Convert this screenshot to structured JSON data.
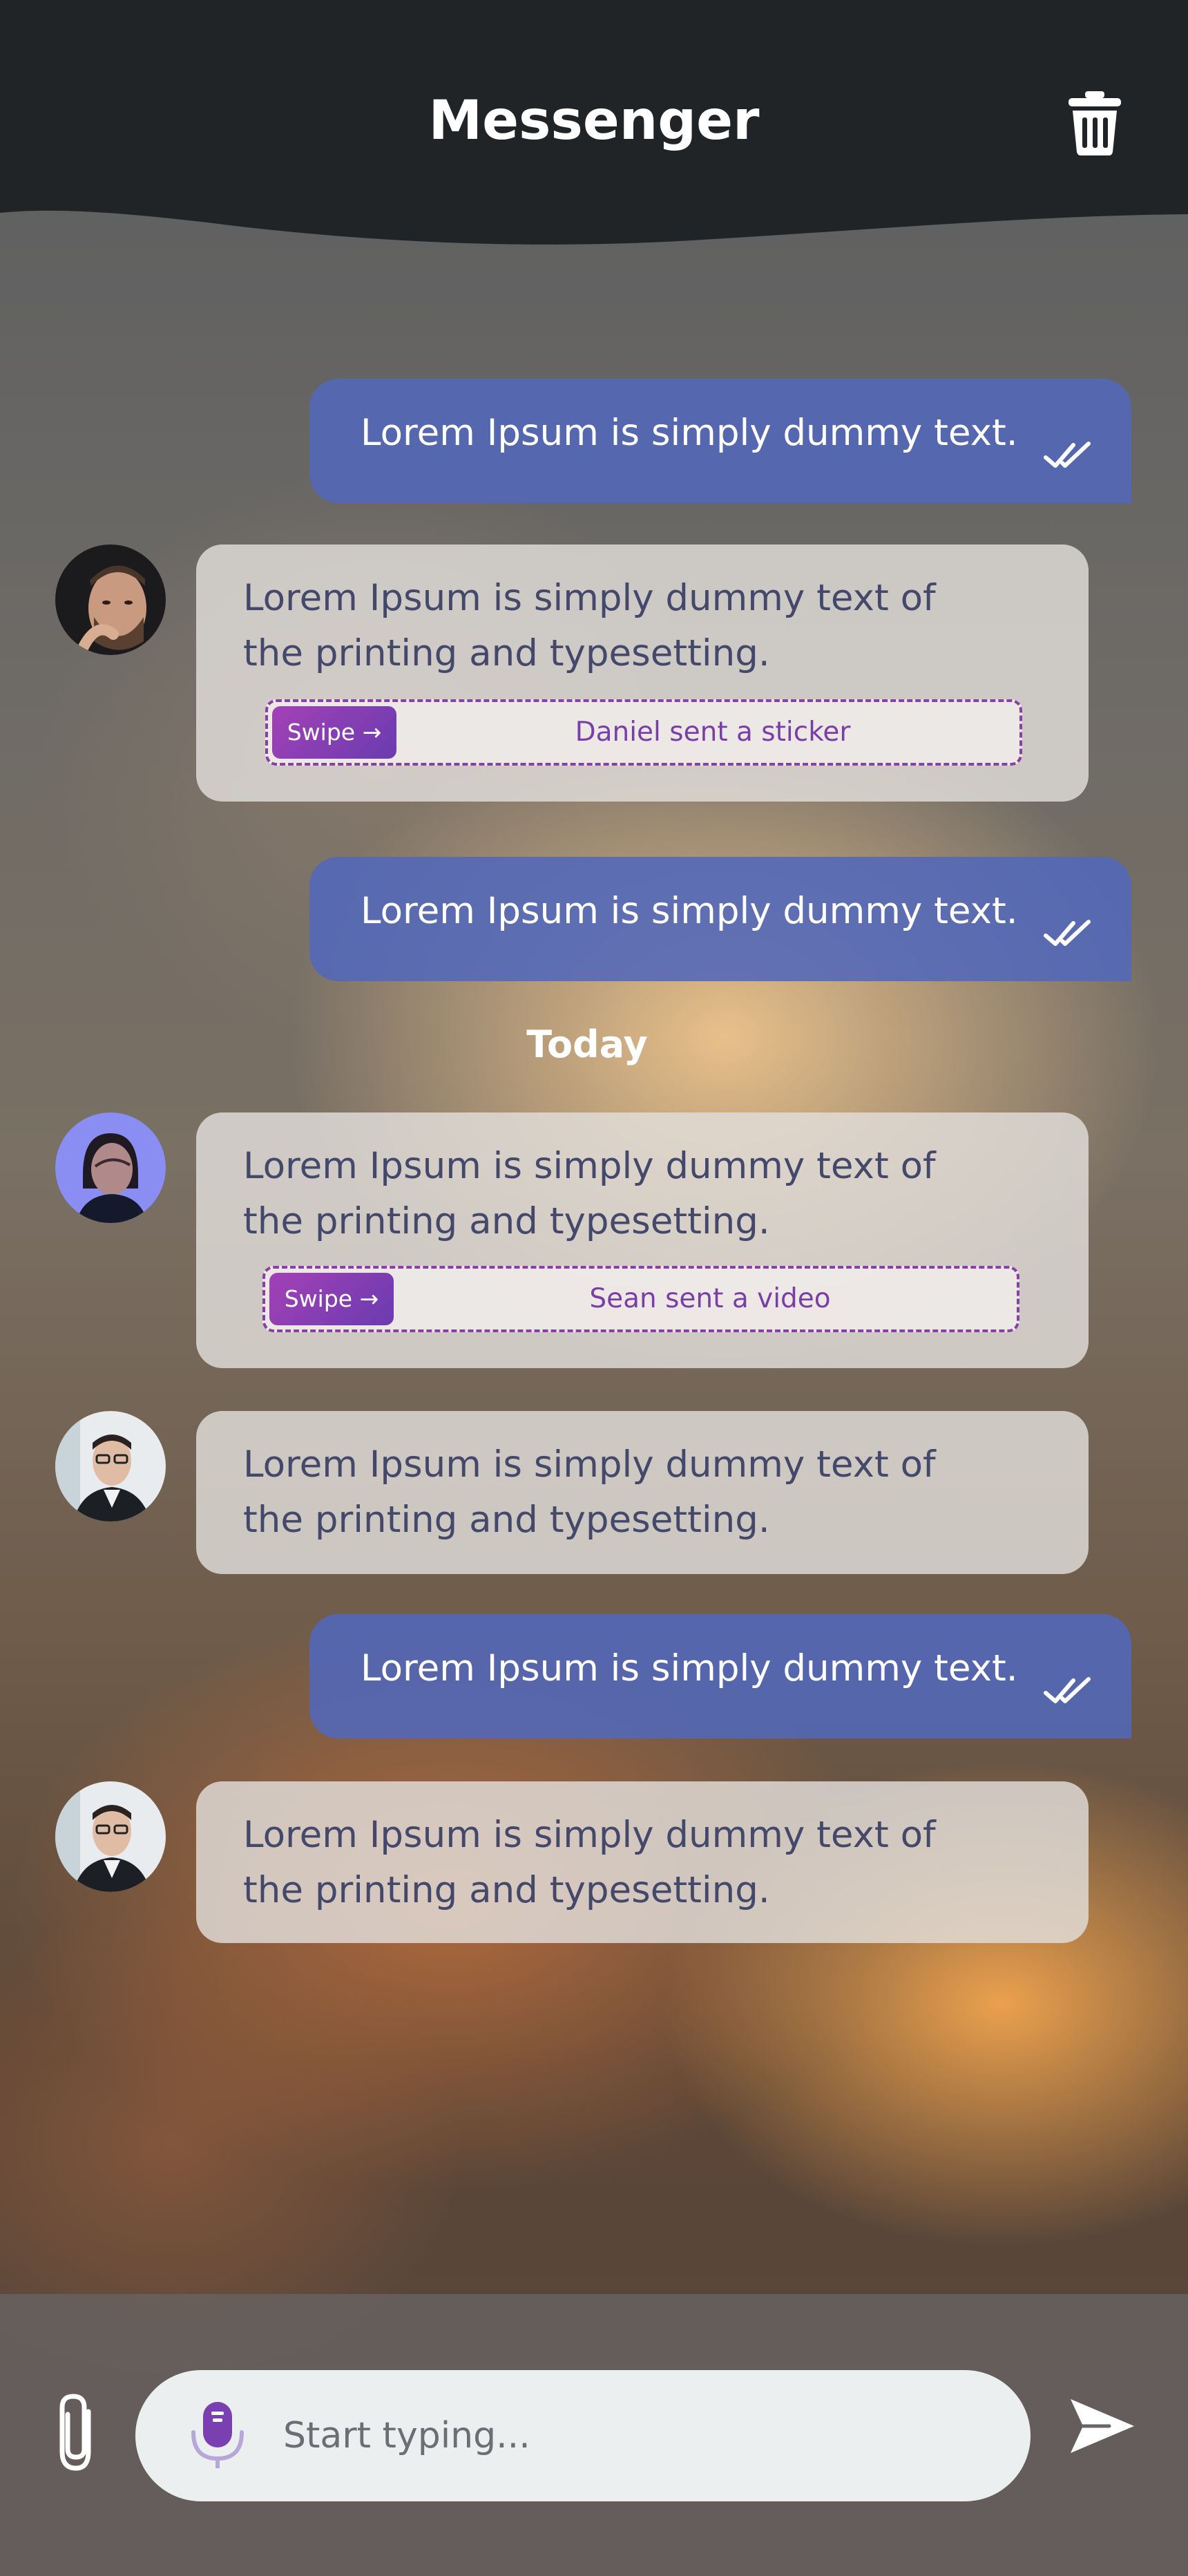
{
  "header": {
    "title": "Messenger",
    "delete_icon": "trash-icon"
  },
  "messages": [
    {
      "direction": "outgoing",
      "text": "Lorem Ipsum is simply dummy text.",
      "status_icon": "double-check-icon"
    },
    {
      "direction": "incoming",
      "avatar": "man-beard-avatar",
      "text": "Lorem Ipsum is simply dummy text of the printing and typesetting.",
      "swipe": {
        "button": "Swipe →",
        "label": "Daniel sent a sticker"
      }
    },
    {
      "direction": "outgoing",
      "text": "Lorem Ipsum is simply dummy text.",
      "status_icon": "double-check-icon"
    },
    {
      "direction": "incoming",
      "avatar": "woman-avatar",
      "text": "Lorem Ipsum is simply dummy text of the printing and typesetting.",
      "swipe": {
        "button": "Swipe →",
        "label": "Sean sent a video"
      }
    },
    {
      "direction": "incoming",
      "avatar": "man-glasses-avatar",
      "text": "Lorem Ipsum is simply dummy text of the printing and typesetting."
    },
    {
      "direction": "outgoing",
      "text": "Lorem Ipsum is simply dummy text.",
      "status_icon": "double-check-icon"
    },
    {
      "direction": "incoming",
      "avatar": "man-glasses-avatar",
      "text": "Lorem Ipsum is simply dummy text of the printing and typesetting."
    }
  ],
  "divider": {
    "label": "Today"
  },
  "composer": {
    "placeholder": "Start typing...",
    "attach_icon": "paperclip-icon",
    "mic_icon": "microphone-icon",
    "send_icon": "send-icon"
  },
  "colors": {
    "outgoing_bubble": "#5268b9",
    "incoming_bubble": "#e2deda",
    "accent": "#8a3fa6"
  }
}
